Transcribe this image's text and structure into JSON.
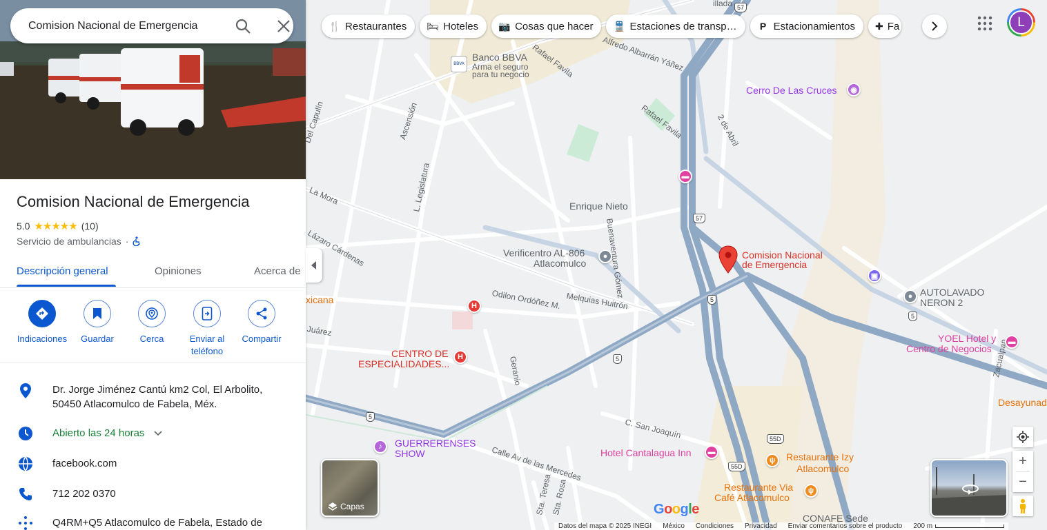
{
  "search": {
    "value": "Comision Nacional de Emergencia"
  },
  "place": {
    "name": "Comision Nacional de Emergencia",
    "rating": "5.0",
    "stars": "★★★★★",
    "reviews": "(10)",
    "category": "Servicio de ambulancias",
    "separator": "·"
  },
  "tabs": [
    {
      "label": "Descripción general"
    },
    {
      "label": "Opiniones"
    },
    {
      "label": "Acerca de"
    }
  ],
  "actions": [
    {
      "label": "Indicaciones"
    },
    {
      "label": "Guardar"
    },
    {
      "label": "Cerca"
    },
    {
      "label": "Enviar al teléfono"
    },
    {
      "label": "Compartir"
    }
  ],
  "info": {
    "address": "Dr. Jorge Jiménez Cantú km2 Col, El Arbolito, 50450 Atlacomulco de Fabela, Méx.",
    "hours": "Abierto las 24 horas",
    "website": "facebook.com",
    "phone": "712 202 0370",
    "pluscode": "Q4RM+Q5 Atlacomulco de Fabela, Estado de"
  },
  "chips": [
    {
      "label": "Restaurantes",
      "icon": "restaurant-icon"
    },
    {
      "label": "Hoteles",
      "icon": "hotel-icon"
    },
    {
      "label": "Cosas que hacer",
      "icon": "camera-icon"
    },
    {
      "label": "Estaciones de transp…",
      "icon": "transit-icon"
    },
    {
      "label": "Estacionamientos",
      "icon": "parking-icon"
    },
    {
      "label": "Fa",
      "icon": "pharmacy-icon"
    }
  ],
  "avatar": {
    "letter": "L"
  },
  "map": {
    "bank": {
      "name": "Banco BBVA",
      "sub1": "Arma el seguro",
      "sub2": "para tu negocio",
      "logo": "BBVA"
    },
    "cerro": "Cerro De Las Cruces",
    "enrique": "Enrique Nieto",
    "verificentro1": "Verificentro AL-806",
    "verificentro2": "Atlacomulco",
    "target1": "Comision Nacional",
    "target2": "de Emergencia",
    "autolavado1": "AUTOLAVADO",
    "autolavado2": "NERON 2",
    "yoel1": "YOEL Hotel y",
    "yoel2": "Centro de Negocios",
    "centro1": "CENTRO DE",
    "centro2": "ESPECIALIDADES...",
    "xicana": "xicana",
    "guerre1": "GUERRERENSES",
    "guerre2": "SHOW",
    "cantalagua": "Hotel Cantalagua Inn",
    "izy1": "Restaurante Izy",
    "izy2": "Atlacomulco",
    "via1": "Restaurante Via",
    "via2": "Café Atlacomulco",
    "desayunad": "Desayunad",
    "conafe": "CONAFE Sede",
    "hospital": "H",
    "streets": {
      "albarran": "Alfredo Albarrán Yáñez",
      "rafael1": "Rafael Favila",
      "rafael2": "Rafael Favila",
      "abril": "2 de Abril",
      "capulin": "Del Capulín",
      "ascension": "Ascensión",
      "legislatura": "L. Legislatura",
      "buenaventura": "Buenaventura Gómez",
      "lamora": "La Mora",
      "lazaro": "Lázaro Cárdenas",
      "odilon": "Odilon Ordóñez M.",
      "melquias": "Melquias Huitrón",
      "geranio": "Geranio",
      "juarez": "Juárez",
      "sanjoaquin": "C. San Joaquín",
      "mercedes": "Calle Av de las Mercedes",
      "zacualpan": "Zacualpan",
      "teresa": "Sta. Teresa",
      "starosa": "Sta. Rosa",
      "villada": "illada"
    },
    "shields": [
      "57",
      "57",
      "5",
      "5",
      "5",
      "5",
      "55D",
      "55D"
    ]
  },
  "controls": {
    "layers": "Capas",
    "zoom_in": "+",
    "zoom_out": "−",
    "google": "Google"
  },
  "footer": {
    "data": "Datos del mapa © 2025 INEGI",
    "country": "México",
    "terms": "Condiciones",
    "privacy": "Privacidad",
    "feedback": "Enviar comentarios sobre el producto",
    "scale": "200 m"
  },
  "colors": {
    "accent": "#0b57d0",
    "open": "#188038",
    "star": "#fbbc04",
    "pin": "#ea4335",
    "road_major": "#8fa8c4"
  }
}
